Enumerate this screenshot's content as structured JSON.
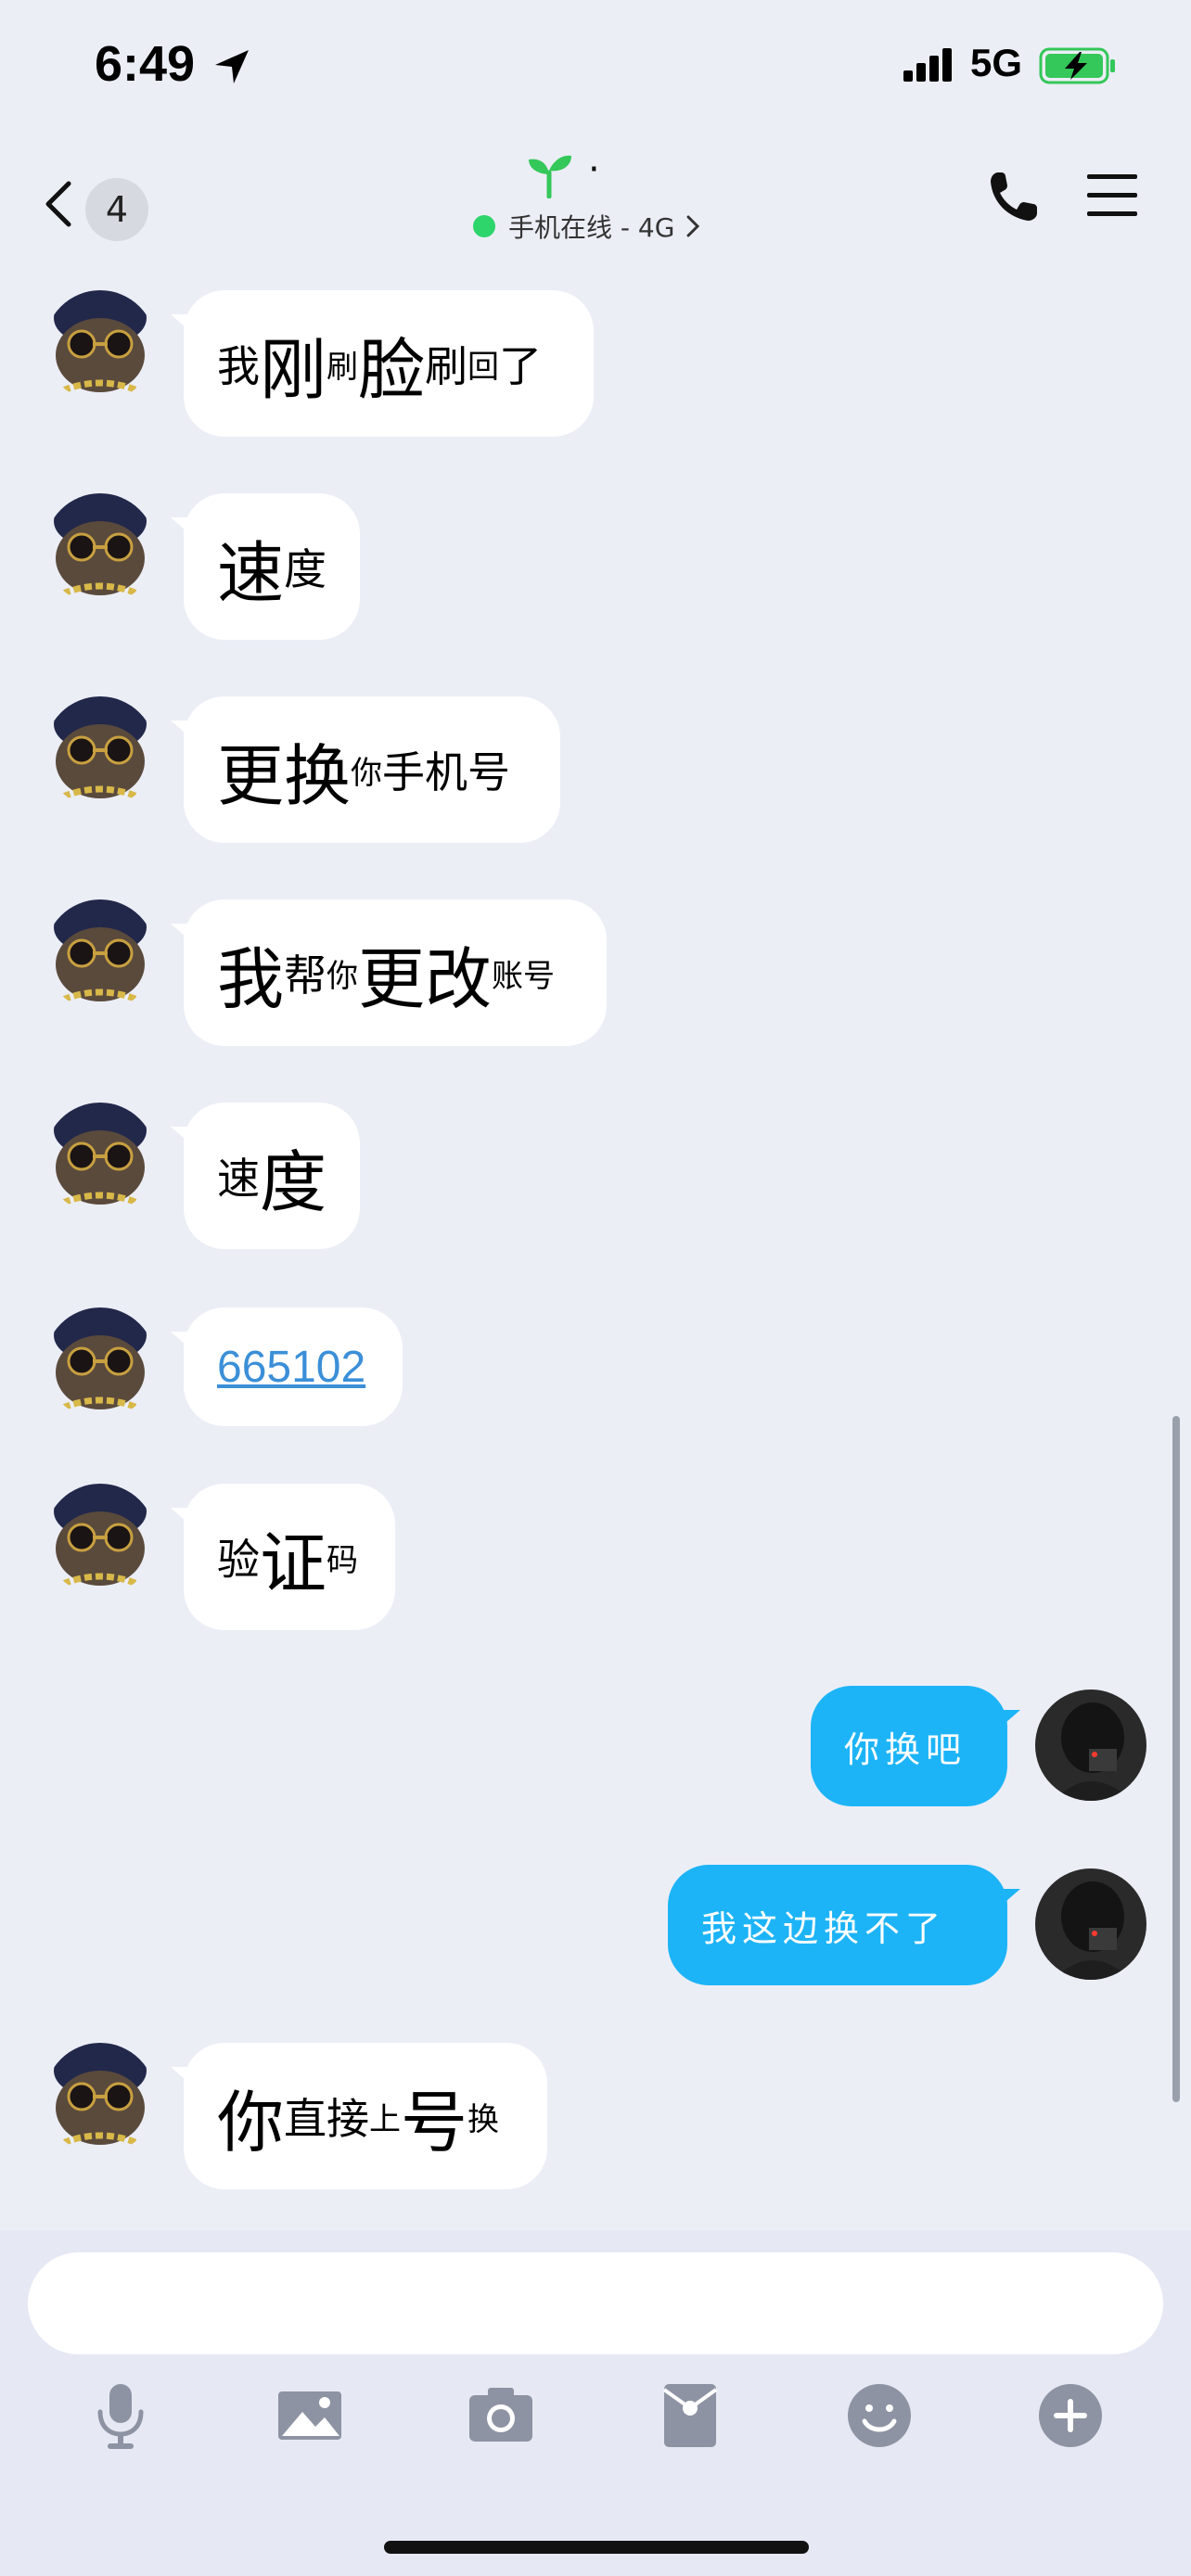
{
  "status_bar": {
    "time": "6:49",
    "network": "5G",
    "icons": [
      "location-arrow-icon",
      "signal-bars-icon",
      "battery-charging-icon"
    ]
  },
  "nav": {
    "back_count": "4",
    "title": "·",
    "title_icon": "sprout-icon",
    "online_status": "手机在线 - 4G",
    "online_color": "#2ed56b",
    "icons": [
      "back-chevron-icon",
      "phone-icon",
      "menu-icon"
    ]
  },
  "messages": [
    {
      "side": "in",
      "parts": [
        {
          "text": "我",
          "size": "mid"
        },
        {
          "text": "刚",
          "size": "big"
        },
        {
          "text": "刷",
          "size": "small"
        },
        {
          "text": "脸",
          "size": "big"
        },
        {
          "text": "刷",
          "size": "mid"
        },
        {
          "text": "回",
          "size": "small"
        },
        {
          "text": "了",
          "size": "mid"
        }
      ]
    },
    {
      "side": "in",
      "parts": [
        {
          "text": "速",
          "size": "big"
        },
        {
          "text": "度",
          "size": "mid"
        }
      ]
    },
    {
      "side": "in",
      "parts": [
        {
          "text": "更换",
          "size": "big"
        },
        {
          "text": "你",
          "size": "small"
        },
        {
          "text": "手机号",
          "size": "mid"
        }
      ]
    },
    {
      "side": "in",
      "parts": [
        {
          "text": "我",
          "size": "big"
        },
        {
          "text": "帮",
          "size": "mid"
        },
        {
          "text": "你",
          "size": "small"
        },
        {
          "text": "更改",
          "size": "big"
        },
        {
          "text": "账号",
          "size": "small"
        }
      ]
    },
    {
      "side": "in",
      "parts": [
        {
          "text": "速",
          "size": "mid"
        },
        {
          "text": "度",
          "size": "big"
        }
      ]
    },
    {
      "side": "in",
      "link": "665102"
    },
    {
      "side": "in",
      "parts": [
        {
          "text": "验",
          "size": "mid"
        },
        {
          "text": "证",
          "size": "big"
        },
        {
          "text": "码",
          "size": "small"
        }
      ]
    },
    {
      "side": "out",
      "text": "你换吧"
    },
    {
      "side": "out",
      "text": "我这边换不了"
    },
    {
      "side": "in",
      "parts": [
        {
          "text": "你",
          "size": "big"
        },
        {
          "text": "直接",
          "size": "mid"
        },
        {
          "text": "上",
          "size": "small"
        },
        {
          "text": "号",
          "size": "big"
        },
        {
          "text": "换",
          "size": "small"
        }
      ]
    }
  ],
  "composer": {
    "placeholder": "",
    "tools": [
      "microphone-icon",
      "image-icon",
      "camera-icon",
      "red-packet-icon",
      "emoji-icon",
      "plus-icon"
    ]
  },
  "colors": {
    "background": "#eceef6",
    "incoming_bubble": "#ffffff",
    "outgoing_bubble": "#1db4f7",
    "link": "#3b8fd8",
    "toolbar_icon": "#8e93a3"
  }
}
